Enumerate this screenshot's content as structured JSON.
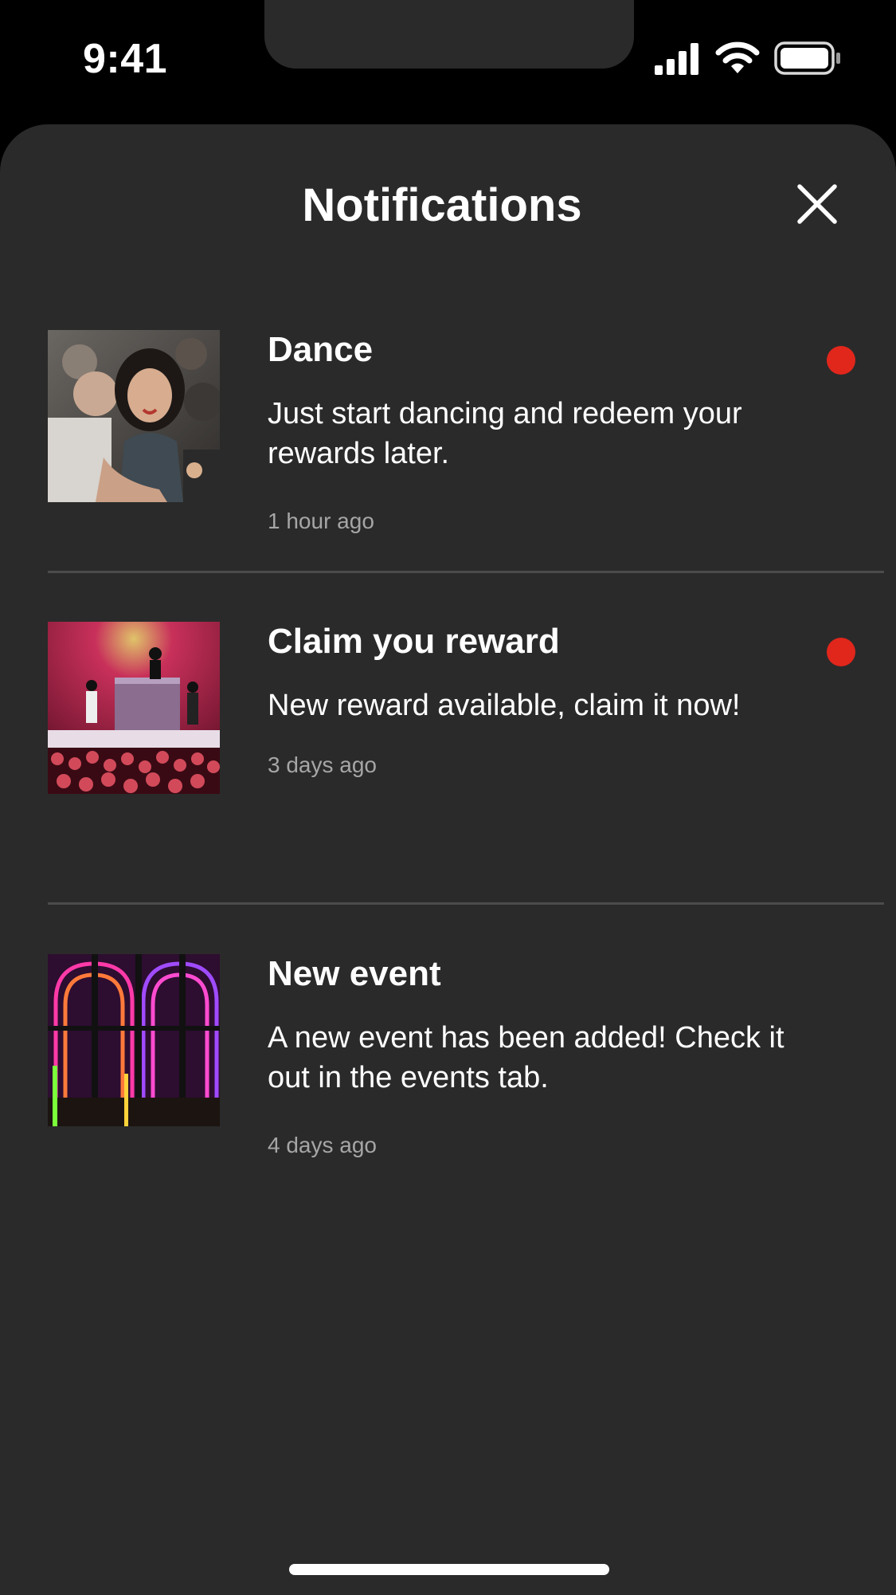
{
  "status_bar": {
    "time": "9:41",
    "icons": [
      "cellular-signal-icon",
      "wifi-icon",
      "battery-icon"
    ]
  },
  "sheet": {
    "title": "Notifications",
    "close_icon": "close-icon"
  },
  "notifications": [
    {
      "title": "Dance",
      "body": "Just start dancing  and redeem your rewards later.",
      "time": "1 hour ago",
      "unread": true,
      "thumbnail": "crowd-photo"
    },
    {
      "title": "Claim you reward",
      "body": "New reward available, claim it now!",
      "time": "3 days ago",
      "unread": true,
      "thumbnail": "stage-photo"
    },
    {
      "title": "New event",
      "body": "A new event has been added! Check it out in the events tab.",
      "time": "4 days ago",
      "unread": false,
      "thumbnail": "neon-arches-photo"
    }
  ],
  "colors": {
    "background": "#000000",
    "sheet": "#2a2a2a",
    "text": "#ffffff",
    "muted_text": "#a6a6a6",
    "unread_dot": "#e1261c",
    "divider": "#4b4b4b"
  }
}
